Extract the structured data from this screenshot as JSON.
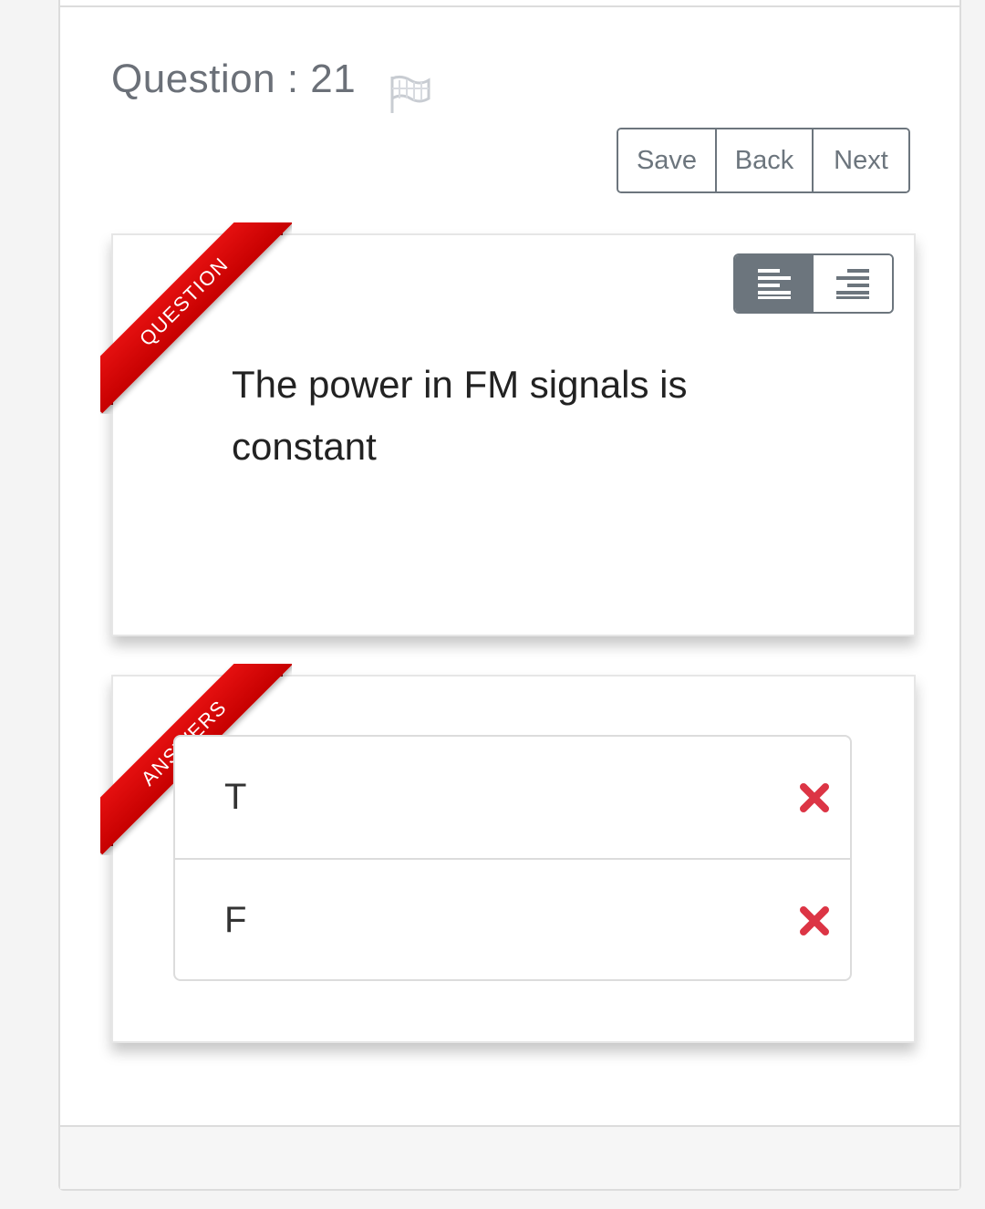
{
  "header": {
    "question_title": "Question : 21",
    "flag_icon": "flag-icon"
  },
  "nav": {
    "save_label": "Save",
    "back_label": "Back",
    "next_label": "Next"
  },
  "question": {
    "ribbon_label": "QUESTION",
    "text": "The power in FM signals is constant",
    "align_buttons": [
      {
        "icon": "align-left-icon",
        "active": true
      },
      {
        "icon": "align-right-icon",
        "active": false
      }
    ]
  },
  "answers": {
    "ribbon_label": "ANSWERS",
    "items": [
      {
        "label": "T",
        "status_icon": "cross-icon"
      },
      {
        "label": "F",
        "status_icon": "cross-icon"
      }
    ]
  },
  "colors": {
    "ribbon": "#d40000",
    "button_border": "#6c757d",
    "wrong_mark": "#dc3545"
  }
}
